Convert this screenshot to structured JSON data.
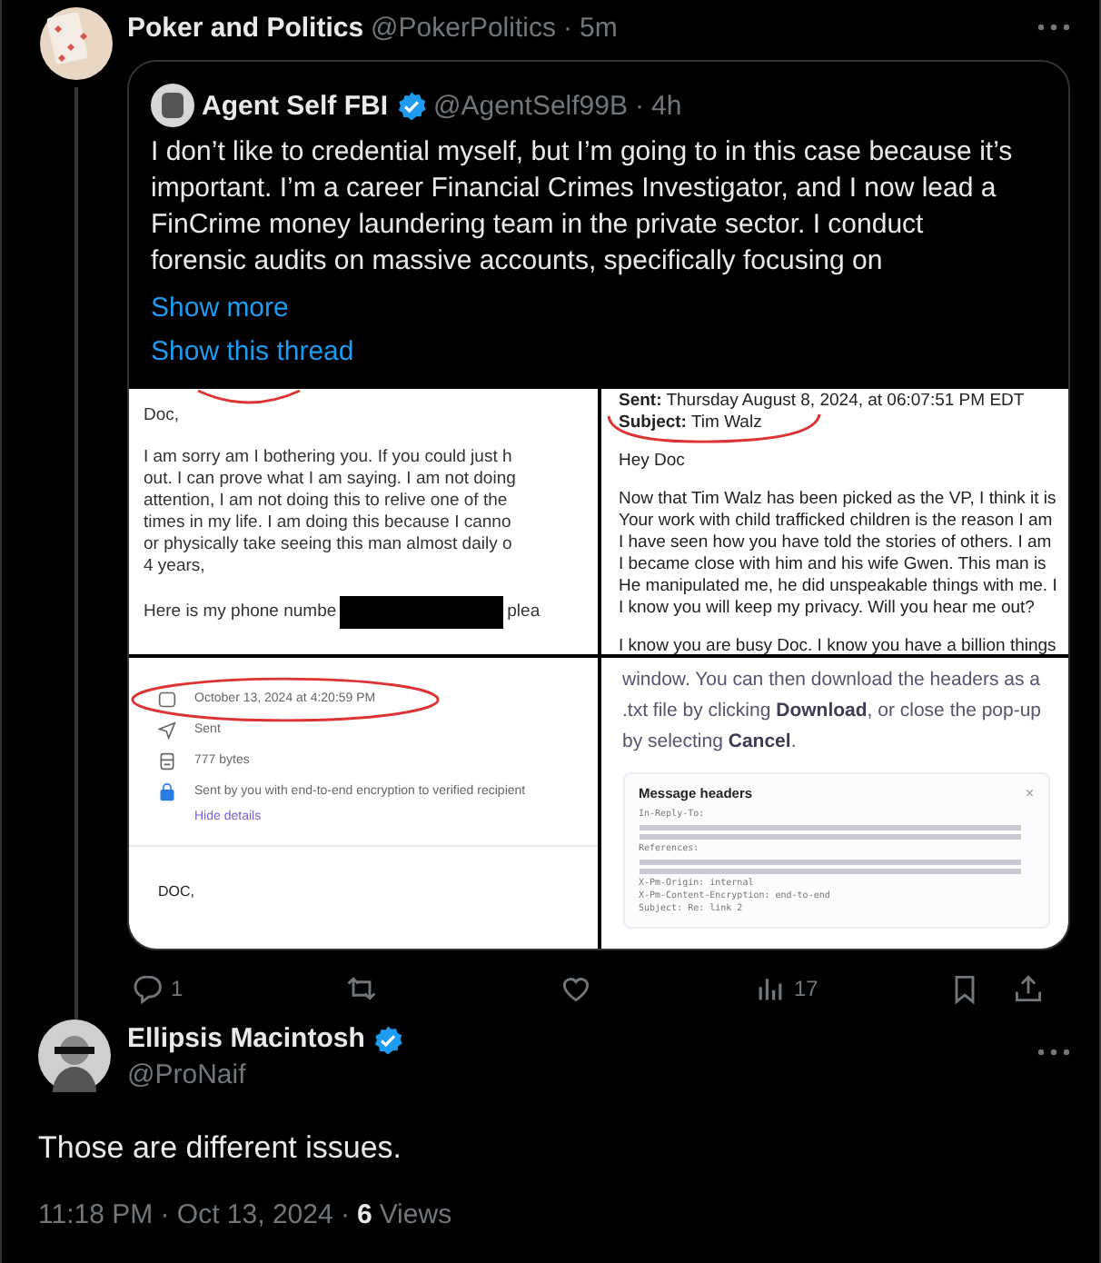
{
  "post": {
    "author": "Poker and Politics",
    "handle": "@PokerPolitics",
    "separator": "·",
    "time": "5m",
    "quote": {
      "author": "Agent Self FBI",
      "verified": true,
      "handle": "@AgentSelf99B",
      "separator": "·",
      "time": "4h",
      "text": "I don’t like to credential myself, but I’m going to in this case because it’s important. I’m a career Financial Crimes Investigator, and I now lead a FinCrime money laundering team in the private sector. I conduct forensic audits on massive accounts, specifically focusing on",
      "show_more": "Show more",
      "show_thread": "Show this thread",
      "images": [
        {
          "kind": "letter",
          "greeting": "Doc,",
          "body": [
            "I am sorry am I bothering you. If you could just h",
            "out. I can prove what I am saying. I am not doing",
            "attention, I am not doing this to relive one of the",
            "times in my life. I am doing this because I canno",
            "or physically take seeing this man almost daily o",
            "4 years,"
          ],
          "phone_before": "Here is my phone numbe",
          "phone_after": "plea"
        },
        {
          "kind": "email",
          "sent_label": "Sent:",
          "sent": "Thursday August 8, 2024, at 06:07:51 PM EDT",
          "subject_label": "Subject:",
          "subject": "Tim Walz",
          "greeting": "Hey Doc",
          "body": [
            "Now that Tim Walz has been picked as the VP, I think it is",
            "Your work with child trafficked children is the reason I am",
            "I have seen how you have told the stories of others. I am",
            "I became close with him and his wife Gwen. This man is",
            "He manipulated me, he did unspeakable things with me. I",
            "I know you will keep my privacy. Will you hear me out?"
          ],
          "closing": "I know you are busy Doc. I know you have a billion things"
        },
        {
          "kind": "details",
          "rows": [
            {
              "kind": "date",
              "text": "October 13, 2024 at 4:20:59 PM"
            },
            {
              "kind": "status",
              "text": "Sent"
            },
            {
              "kind": "size",
              "text": "777 bytes"
            },
            {
              "kind": "security",
              "text": "Sent by you with end-to-end encryption to verified recipient"
            }
          ],
          "link": "Hide details",
          "greeting": "DOC,"
        },
        {
          "kind": "help",
          "text": "window. You can then download the headers as a .txt file by clicking **Download**, or close the pop-up by selecting **Cancel**.",
          "dialog_title": "Message headers",
          "close": "×",
          "lines": [
            {
              "kind": "text",
              "text": "In-Reply-To:"
            },
            {
              "kind": "blur"
            },
            {
              "kind": "blur"
            },
            {
              "kind": "text",
              "text": "References:"
            },
            {
              "kind": "blur"
            },
            {
              "kind": "blur"
            },
            {
              "kind": "text",
              "text": "X-Pm-Origin: internal"
            },
            {
              "kind": "text",
              "text": "X-Pm-Content-Encryption: end-to-end"
            },
            {
              "kind": "text",
              "text": "Subject: Re: link 2"
            }
          ]
        }
      ]
    },
    "actions": [
      {
        "kind": "reply",
        "count": "1"
      },
      {
        "kind": "repost"
      },
      {
        "kind": "like"
      },
      {
        "kind": "views",
        "count": "17"
      },
      {
        "kind": "bookmark"
      },
      {
        "kind": "share"
      }
    ]
  },
  "reply": {
    "author": "Ellipsis Macintosh",
    "verified": true,
    "handle": "@ProNaif",
    "text": "Those are different issues.",
    "time": "11:18 PM · Oct 13, 2024 ·",
    "views_count": "6",
    "views_label": "Views"
  }
}
